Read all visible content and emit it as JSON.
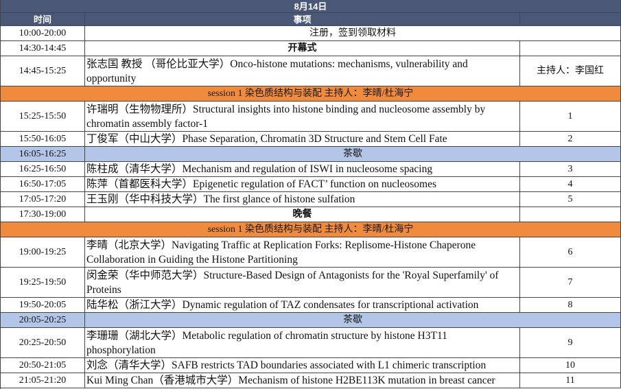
{
  "schedule": {
    "date": "8月14日",
    "columns": {
      "time": "时间",
      "item": "事项"
    },
    "rows": [
      {
        "time": "10:00-20:00",
        "item": "注册，签到领取材料"
      },
      {
        "time": "14:30-14:45",
        "item": "开幕式"
      },
      {
        "time": "14:45-15:25",
        "item": "张志国 教授 （哥伦比亚大学）Onco-histone mutations: mechanisms, vulnerability and opportunity",
        "host": "主持人：李国红"
      },
      {
        "item": "session 1 染色质结构与装配 主持人：李晴/杜海宁"
      },
      {
        "time": "15:25-15:50",
        "item": "许瑞明（生物物理所）Structural insights into histone binding and nucleosome assembly by chromatin assembly factor-1",
        "no": "1"
      },
      {
        "time": "15:50-16:05",
        "item": "丁俊军（中山大学）Phase Separation, Chromatin 3D Structure and Stem Cell Fate",
        "no": "2"
      },
      {
        "time": "16:05-16:25",
        "item": "茶歇"
      },
      {
        "time": "16:25-16:50",
        "item": "陈柱成（清华大学）Mechanism and regulation of ISWI in nucleosome spacing",
        "no": "3"
      },
      {
        "time": "16:50-17:05",
        "item": "陈萍（首都医科大学）Epigenetic regulation of FACT’ function on nucleosomes",
        "no": "4"
      },
      {
        "time": "17:05-17:20",
        "item": "王玉刚（华中科技大学）The first glance of histone sulfation",
        "no": "5"
      },
      {
        "time": "17:30-19:00",
        "item": "晚餐"
      },
      {
        "item": "session 1 染色质结构与装配 主持人：李晴/杜海宁"
      },
      {
        "time": "19:00-19:25",
        "item": "李晴（北京大学）Navigating Traffic at Replication Forks: Replisome-Histone Chaperone Collaboration in Guiding the Histone Partitioning",
        "no": "6"
      },
      {
        "time": "19:25-19:50",
        "item": "闵金荣（华中师范大学）Structure-Based Design of Antagonists for the 'Royal Superfamily' of Proteins",
        "no": "7"
      },
      {
        "time": "19:50-20:05",
        "item": "陆华松（浙江大学）Dynamic regulation of TAZ condensates for transcriptional activation",
        "no": "8"
      },
      {
        "time": "20:05-20:25",
        "item": "茶歇"
      },
      {
        "time": "20:25-20:50",
        "item": "李珊珊（湖北大学）Metabolic regulation of chromatin structure by histone H3T11 phosphorylation",
        "no": "9"
      },
      {
        "time": "20:50-21:05",
        "item": "刘念（清华大学）SAFB restricts TAD boundaries associated with L1 chimeric transcription",
        "no": "10"
      },
      {
        "time": "21:05-21:20",
        "item": "Kui Ming Chan（香港城市大学）Mechanism of histone H2BE113K mutation in breast cancer",
        "no": "11"
      }
    ]
  },
  "colors": {
    "header": "#4a5876",
    "session": "#f08a3c",
    "break": "#b4c6e7"
  }
}
